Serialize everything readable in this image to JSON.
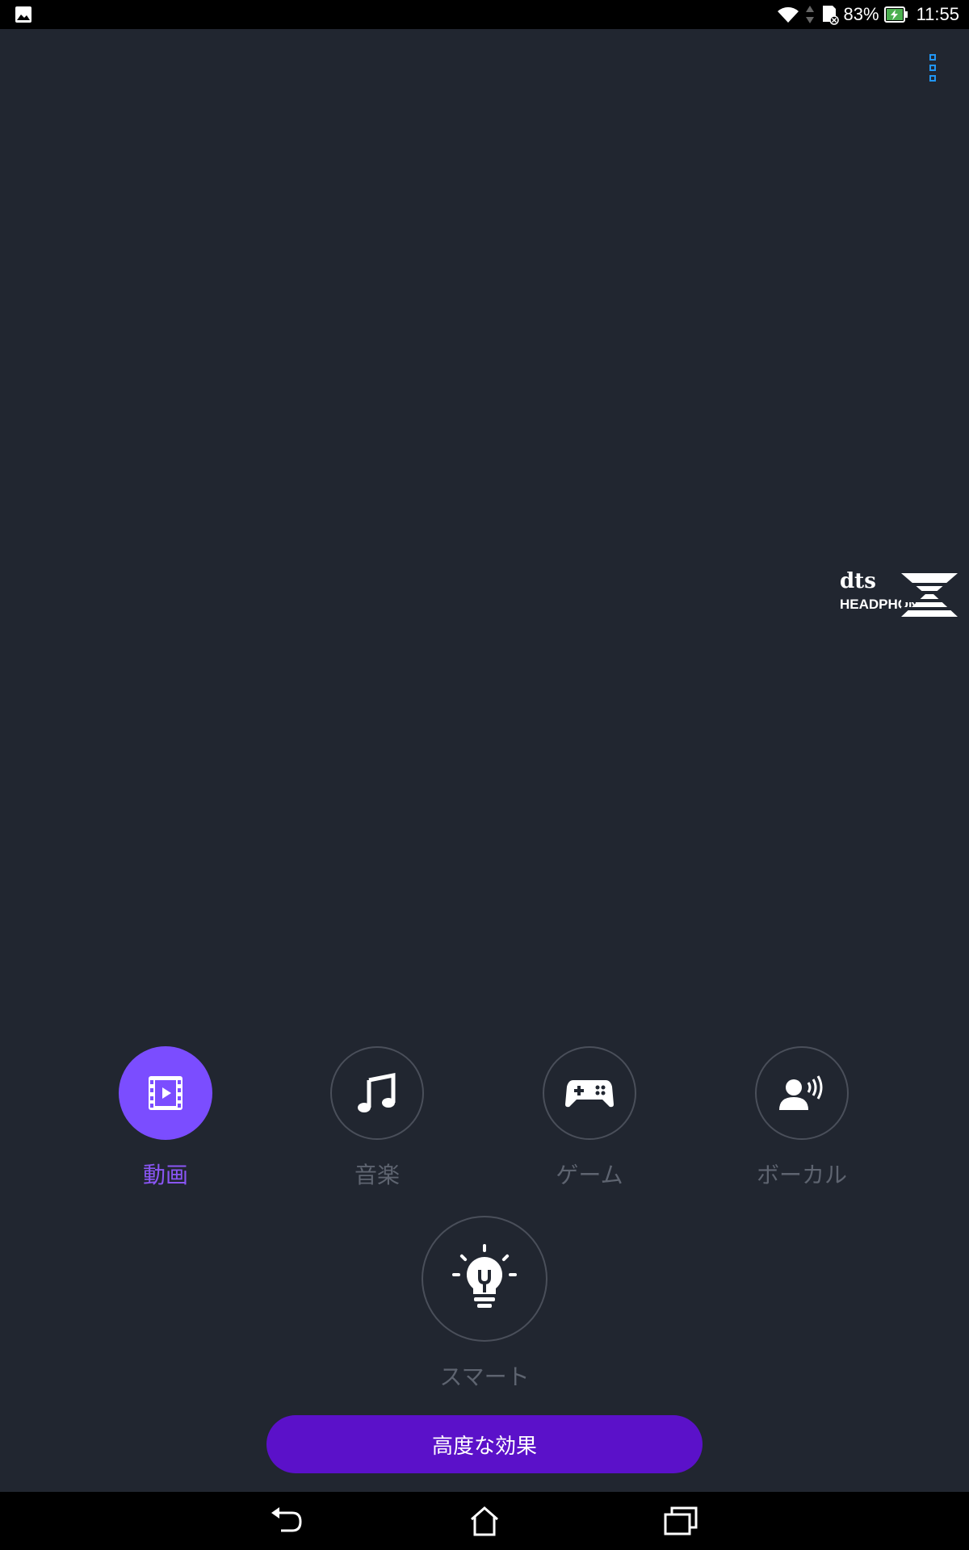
{
  "status_bar": {
    "battery_percent": "83%",
    "time": "11:55",
    "icons": [
      "image-icon",
      "wifi-icon",
      "data-arrows-icon",
      "sd-card-icon",
      "battery-charging-icon"
    ]
  },
  "menu": {
    "icon": "overflow-menu-icon"
  },
  "logo": {
    "brand": "dts",
    "product": "HEADPHONE",
    "mark": "X"
  },
  "modes": [
    {
      "label": "動画",
      "icon": "film-icon",
      "active": true
    },
    {
      "label": "音楽",
      "icon": "music-note-icon",
      "active": false
    },
    {
      "label": "ゲーム",
      "icon": "gamepad-icon",
      "active": false
    },
    {
      "label": "ボーカル",
      "icon": "voice-icon",
      "active": false
    }
  ],
  "smart": {
    "label": "スマート",
    "icon": "lightbulb-icon"
  },
  "advanced_button": {
    "label": "高度な効果"
  },
  "colors": {
    "background": "#212630",
    "accent": "#7b4dff",
    "active_label": "#8a55f5",
    "button": "#5b11c9",
    "menu_dots": "#2196f3"
  },
  "nav": {
    "icons": [
      "back-icon",
      "home-icon",
      "recents-icon"
    ]
  }
}
